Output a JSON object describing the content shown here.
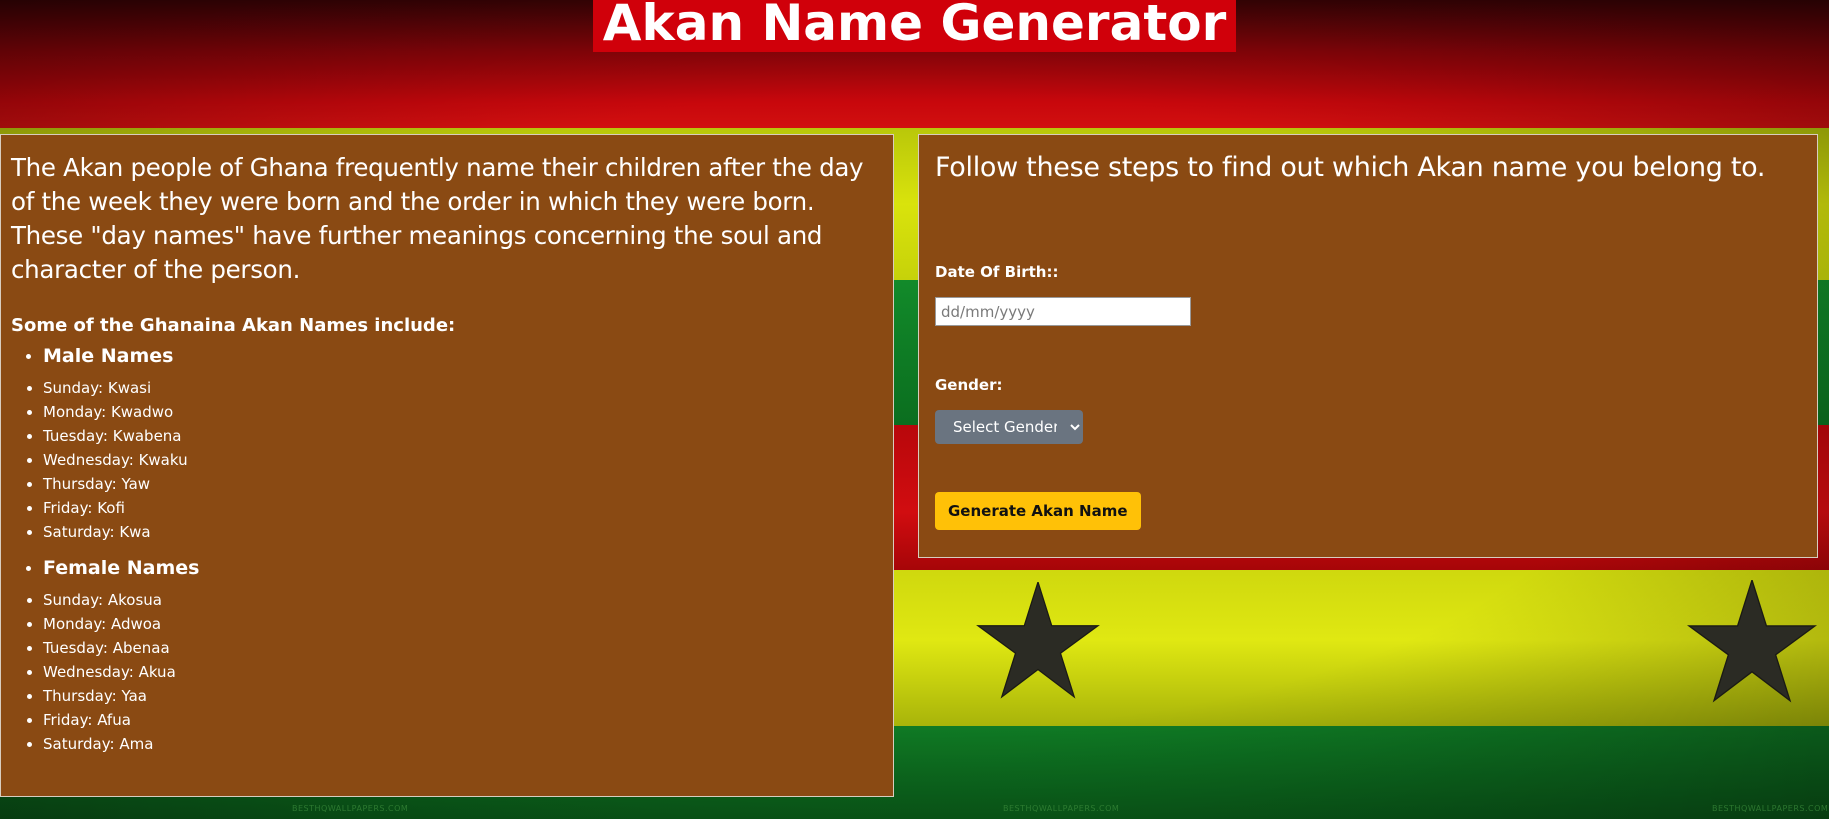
{
  "header": {
    "title": "Akan Name Generator"
  },
  "info": {
    "intro": "The Akan people of Ghana frequently name their children after the day of the week they were born and the order in which they were born. These \"day names\" have further meanings concerning the soul and character of the person.",
    "list_heading": "Some of the Ghanaina Akan Names include:",
    "male": {
      "title": "Male Names",
      "days": [
        "Sunday: Kwasi",
        "Monday: Kwadwo",
        "Tuesday: Kwabena",
        "Wednesday: Kwaku",
        "Thursday: Yaw",
        "Friday: Kofi",
        "Saturday: Kwa"
      ]
    },
    "female": {
      "title": "Female Names",
      "days": [
        "Sunday: Akosua",
        "Monday: Adwoa",
        "Tuesday: Abenaa",
        "Wednesday: Akua",
        "Thursday: Yaa",
        "Friday: Afua",
        "Saturday: Ama"
      ]
    }
  },
  "form": {
    "steps_title": "Follow these steps to find out which Akan name you belong to.",
    "dob_label": "Date Of Birth::",
    "dob_placeholder": "dd/mm/yyyy",
    "dob_value": "",
    "gender_label": "Gender:",
    "gender_selected": "Select Gender",
    "submit_label": "Generate Akan Name"
  },
  "background": {
    "watermark": "BESTHQWALLPAPERS.COM"
  },
  "colors": {
    "panel": "#8a4a13",
    "title_bg": "#d0000a",
    "button": "#ffc107",
    "select": "#6a7480"
  },
  "icons": {
    "star": "star-icon",
    "select_arrow": "chevron-down-icon"
  }
}
